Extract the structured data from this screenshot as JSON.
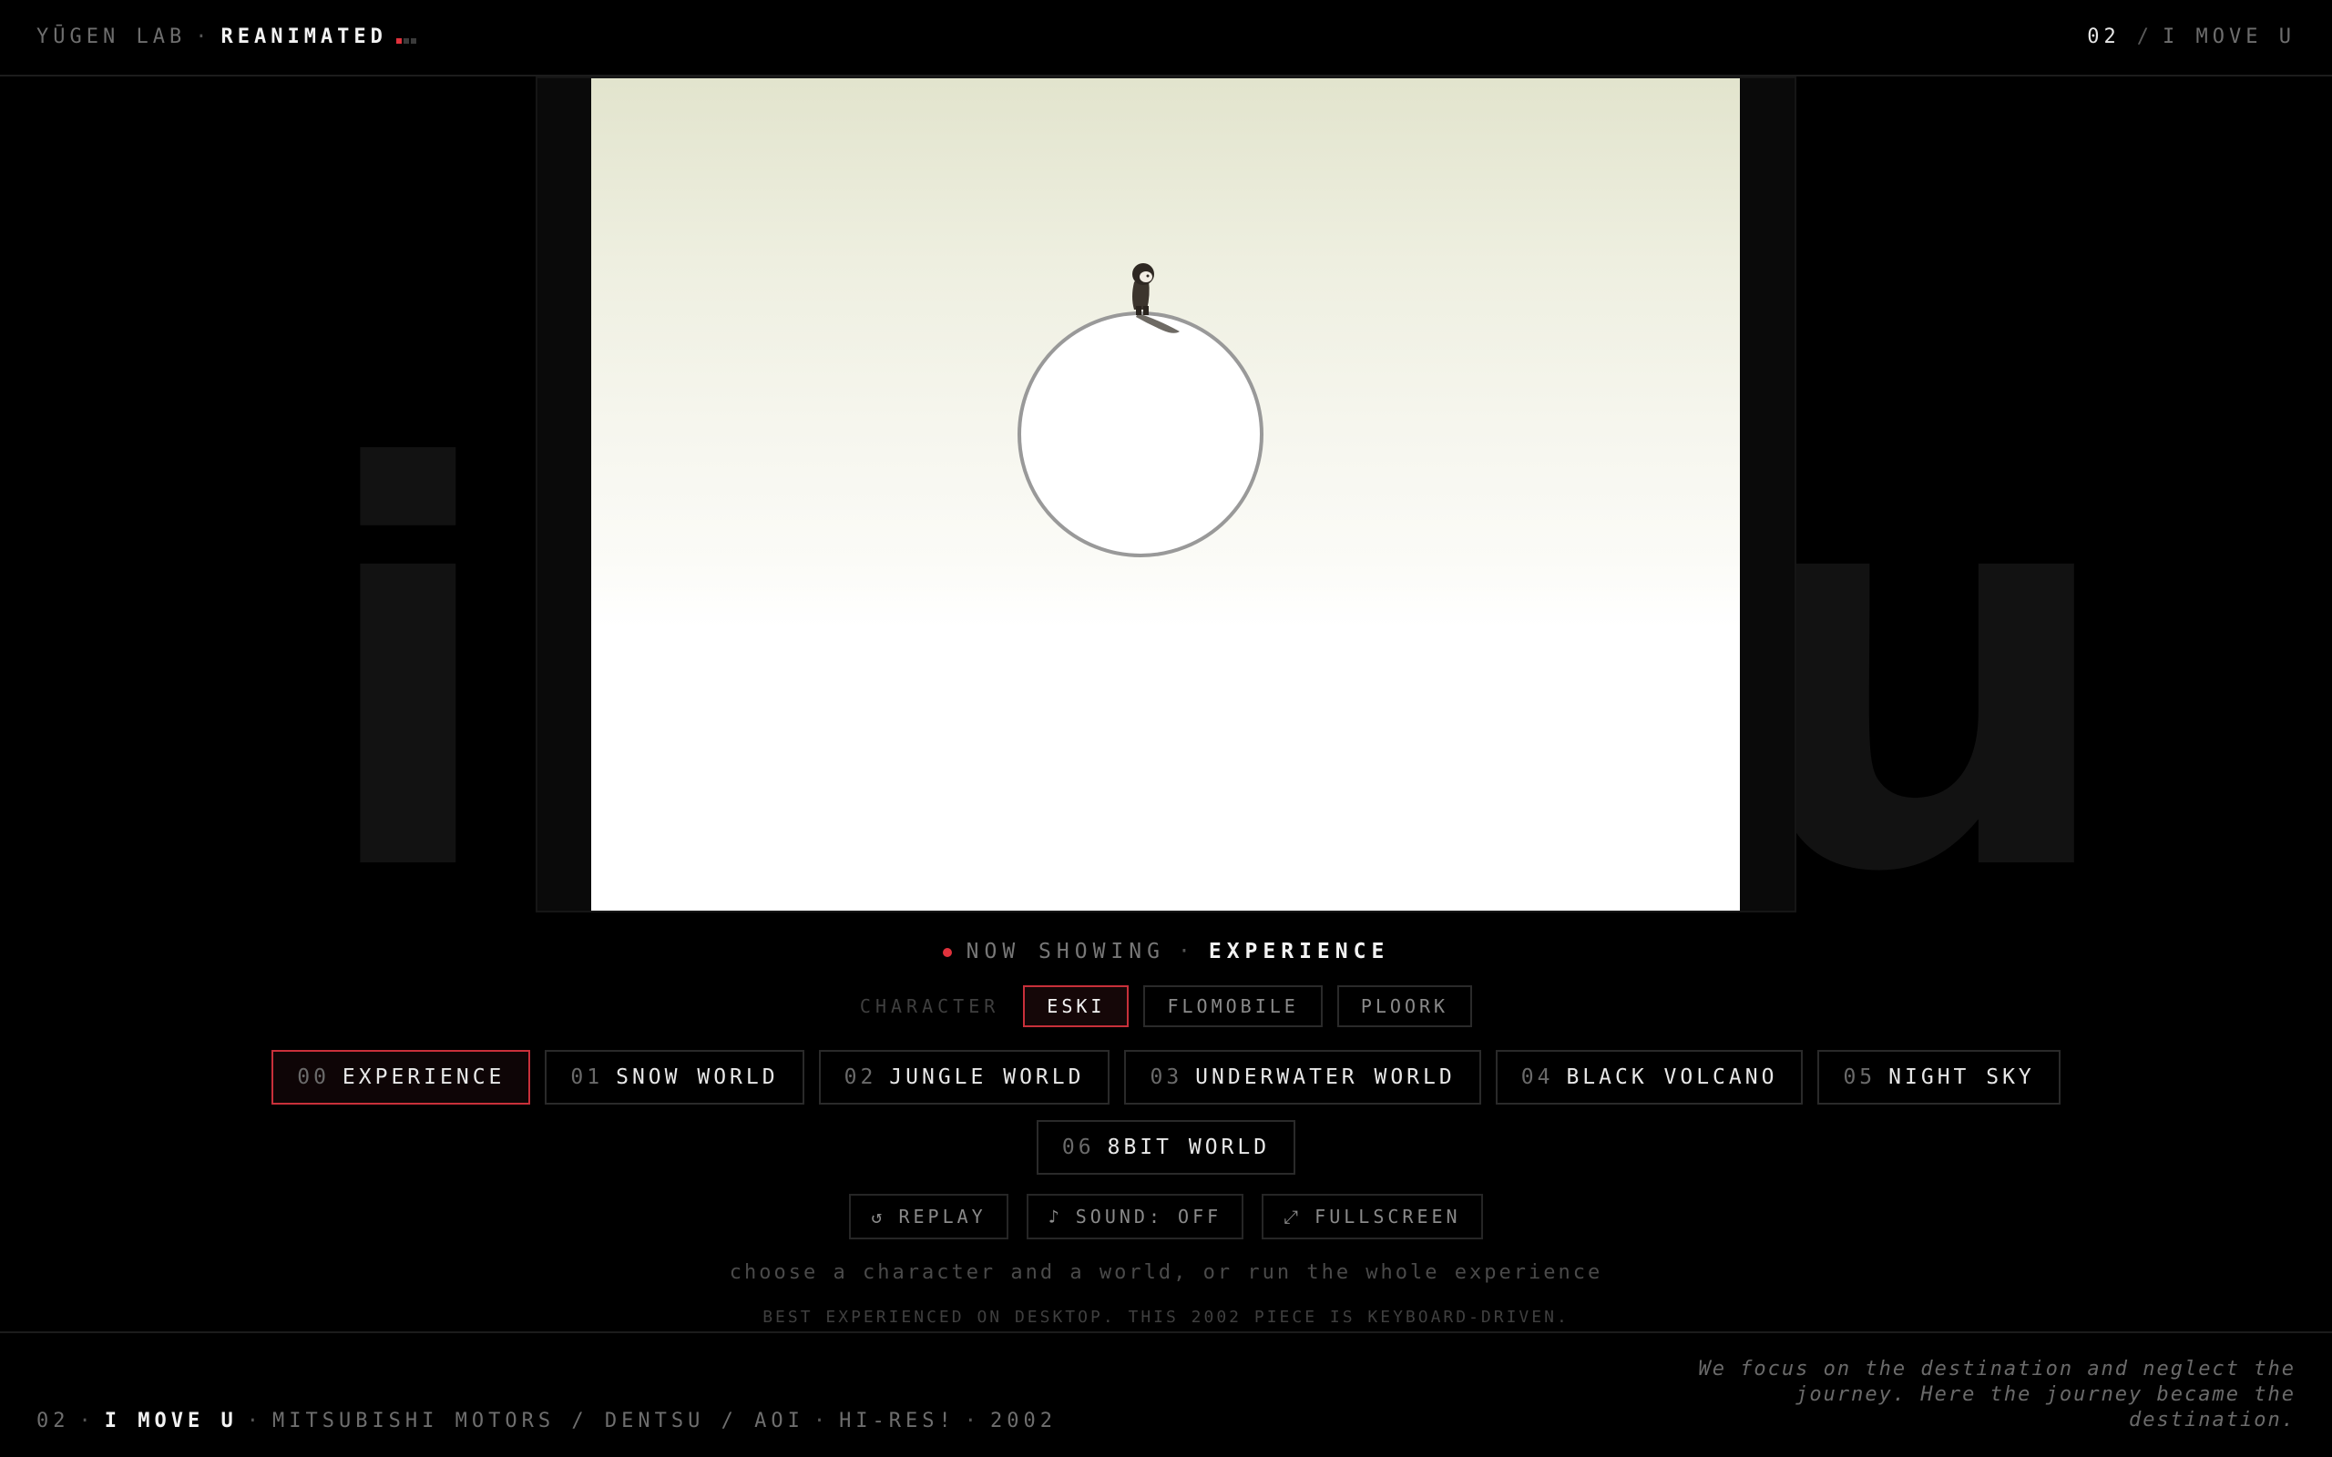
{
  "header": {
    "brand_lab": "YŪGEN LAB",
    "brand_sep": "·",
    "brand_name": "REANIMATED",
    "page_number": "02",
    "page_sep": "/",
    "page_title": "I MOVE U"
  },
  "background_letters": {
    "left": "i",
    "right": "u"
  },
  "now_showing": {
    "label": "NOW SHOWING",
    "sep": "·",
    "value": "EXPERIENCE"
  },
  "character": {
    "label": "CHARACTER",
    "options": [
      "ESKI",
      "FLOMOBILE",
      "PLOORK"
    ],
    "selected": "ESKI"
  },
  "worlds": [
    {
      "num": "00",
      "label": "EXPERIENCE",
      "active": true
    },
    {
      "num": "01",
      "label": "SNOW WORLD",
      "active": false
    },
    {
      "num": "02",
      "label": "JUNGLE WORLD",
      "active": false
    },
    {
      "num": "03",
      "label": "UNDERWATER WORLD",
      "active": false
    },
    {
      "num": "04",
      "label": "BLACK VOLCANO",
      "active": false
    },
    {
      "num": "05",
      "label": "NIGHT SKY",
      "active": false
    },
    {
      "num": "06",
      "label": "8BIT WORLD",
      "active": false
    }
  ],
  "controls": {
    "replay": {
      "icon": "↺",
      "label": "REPLAY"
    },
    "sound": {
      "icon": "♪",
      "label": "SOUND: OFF"
    },
    "fullscreen": {
      "icon": "⤢",
      "label": "FULLSCREEN"
    }
  },
  "hint": "choose a character and a world, or run the whole experience",
  "note": "BEST EXPERIENCED ON DESKTOP. THIS 2002 PIECE IS KEYBOARD-DRIVEN.",
  "footer": {
    "num": "02",
    "sep": "·",
    "title": "I MOVE U",
    "credits": "MITSUBISHI MOTORS / DENTSU / AOI",
    "award": "HI-RES!",
    "year": "2002",
    "quote": "We focus on the destination and neglect the journey. Here the journey became the destination."
  },
  "colors": {
    "accent": "#e0323c",
    "background": "#000000",
    "canvas_top": "#e2e4cd",
    "canvas_bottom": "#ffffff"
  }
}
